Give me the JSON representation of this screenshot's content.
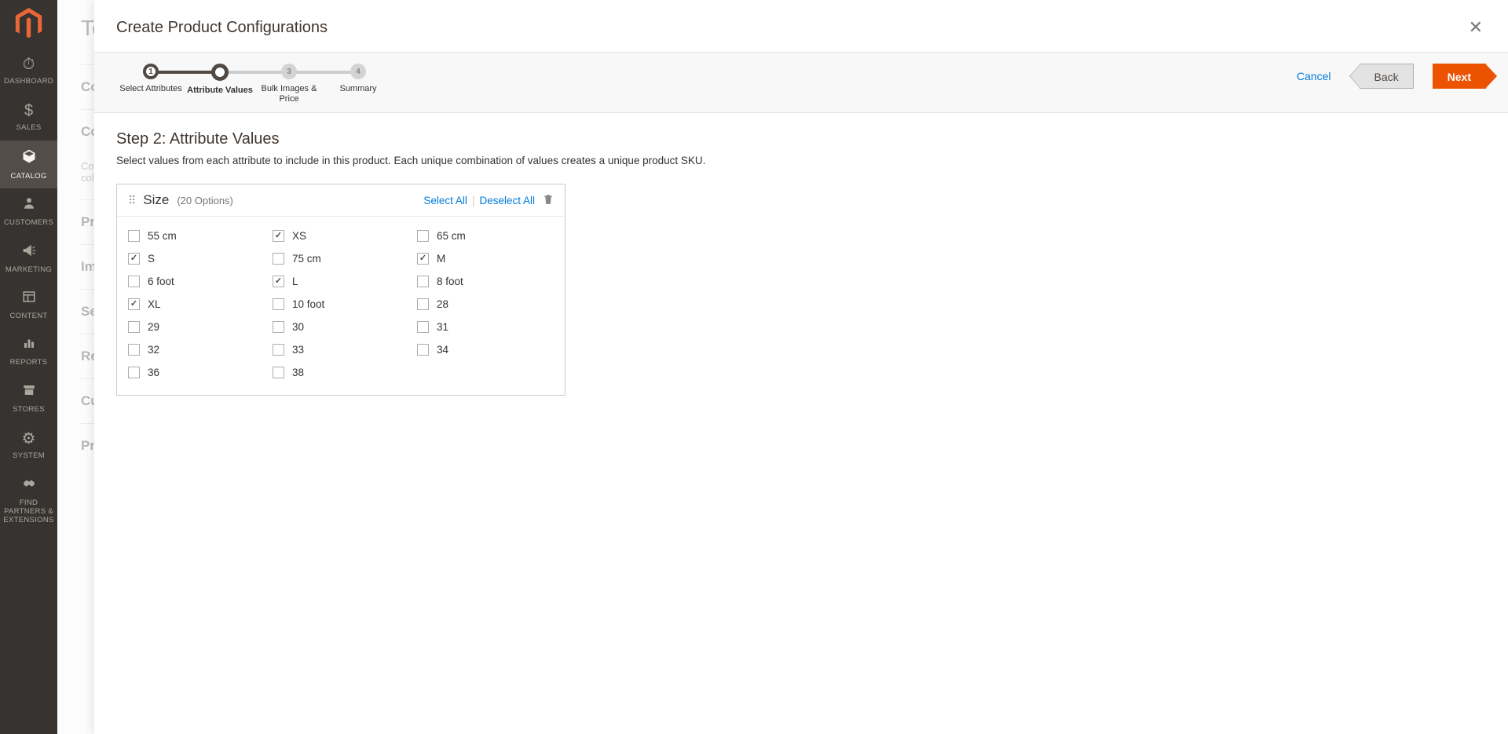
{
  "sidebar": {
    "items": [
      {
        "label": "DASHBOARD"
      },
      {
        "label": "SALES"
      },
      {
        "label": "CATALOG"
      },
      {
        "label": "CUSTOMERS"
      },
      {
        "label": "MARKETING"
      },
      {
        "label": "CONTENT"
      },
      {
        "label": "REPORTS"
      },
      {
        "label": "STORES"
      },
      {
        "label": "SYSTEM"
      },
      {
        "label": "FIND PARTNERS & EXTENSIONS"
      }
    ]
  },
  "bg": {
    "title": "Test",
    "sections": [
      "Co",
      "Co",
      "Pro",
      "Ima",
      "Sea",
      "Rel",
      "Cus",
      "Pro"
    ],
    "hint1": "Co",
    "hint2": "col"
  },
  "modal": {
    "title": "Create Product Configurations",
    "cancel": "Cancel",
    "back": "Back",
    "next": "Next",
    "steps": [
      {
        "num": "1",
        "label": "Select Attributes"
      },
      {
        "num": "",
        "label": "Attribute Values"
      },
      {
        "num": "3",
        "label": "Bulk Images & Price"
      },
      {
        "num": "4",
        "label": "Summary"
      }
    ],
    "step_title": "Step 2: Attribute Values",
    "step_desc": "Select values from each attribute to include in this product. Each unique combination of values creates a unique product SKU.",
    "attribute": {
      "name": "Size",
      "count_label": "(20 Options)",
      "select_all": "Select All",
      "deselect_all": "Deselect All",
      "options": [
        {
          "label": "55 cm",
          "checked": false
        },
        {
          "label": "XS",
          "checked": true
        },
        {
          "label": "65 cm",
          "checked": false
        },
        {
          "label": "S",
          "checked": true
        },
        {
          "label": "75 cm",
          "checked": false
        },
        {
          "label": "M",
          "checked": true
        },
        {
          "label": "6 foot",
          "checked": false
        },
        {
          "label": "L",
          "checked": true
        },
        {
          "label": "8 foot",
          "checked": false
        },
        {
          "label": "XL",
          "checked": true
        },
        {
          "label": "10 foot",
          "checked": false
        },
        {
          "label": "28",
          "checked": false
        },
        {
          "label": "29",
          "checked": false
        },
        {
          "label": "30",
          "checked": false
        },
        {
          "label": "31",
          "checked": false
        },
        {
          "label": "32",
          "checked": false
        },
        {
          "label": "33",
          "checked": false
        },
        {
          "label": "34",
          "checked": false
        },
        {
          "label": "36",
          "checked": false
        },
        {
          "label": "38",
          "checked": false
        }
      ]
    }
  }
}
